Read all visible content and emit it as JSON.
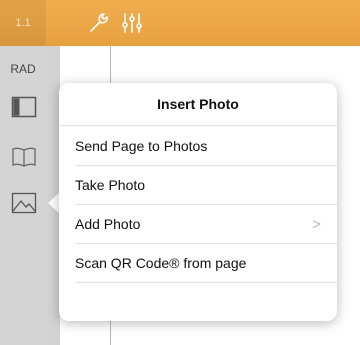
{
  "topbar": {
    "page_number": "1.1",
    "tools": [
      "wrench-icon",
      "sliders-icon"
    ],
    "accent": "#eda446"
  },
  "sidebar": {
    "mode": "RAD",
    "icons": [
      "layout-panel-icon",
      "book-icon",
      "photo-icon"
    ]
  },
  "popover": {
    "title": "Insert Photo",
    "items": [
      {
        "label": "Send Page to Photos",
        "has_chevron": false
      },
      {
        "label": "Take Photo",
        "has_chevron": false
      },
      {
        "label": "Add Photo",
        "has_chevron": true,
        "chevron": ">"
      },
      {
        "label": "Scan QR Code® from page",
        "has_chevron": false
      }
    ]
  }
}
